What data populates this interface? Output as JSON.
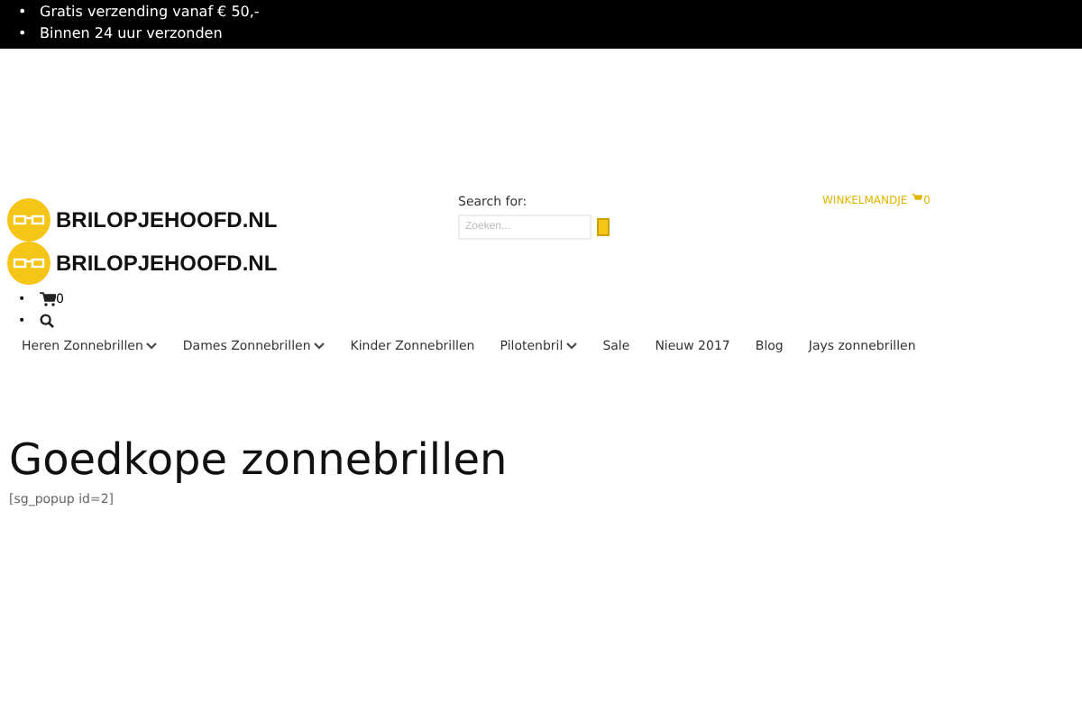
{
  "list_marker": "•",
  "top_bar": {
    "items": [
      "Gratis verzending vanaf € 50,-",
      "Binnen 24 uur verzonden"
    ]
  },
  "header": {
    "logo": "BRILOPJEHOOFD.NL",
    "search_label": "Search for:",
    "search": {
      "placeholder": "Zoeken..."
    },
    "cart_label": "WINKELMANDJE",
    "cart_count": "0"
  },
  "mobile_header": {
    "logo": "BRILOPJEHOOFD.NL",
    "cart_count": "0"
  },
  "nav": [
    {
      "label": "Heren Zonnebrillen",
      "dropdown": true
    },
    {
      "label": "Dames Zonnebrillen",
      "dropdown": true
    },
    {
      "label": "Kinder Zonnebrillen",
      "dropdown": false
    },
    {
      "label": "Pilotenbril",
      "dropdown": true
    },
    {
      "label": "Sale",
      "dropdown": false
    },
    {
      "label": "Nieuw 2017",
      "dropdown": false
    },
    {
      "label": "Blog",
      "dropdown": false
    },
    {
      "label": "Jays zonnebrillen",
      "dropdown": false
    }
  ],
  "page": {
    "title": "Goedkope zonnebrillen",
    "shortcode": "[sg_popup id=2]"
  }
}
